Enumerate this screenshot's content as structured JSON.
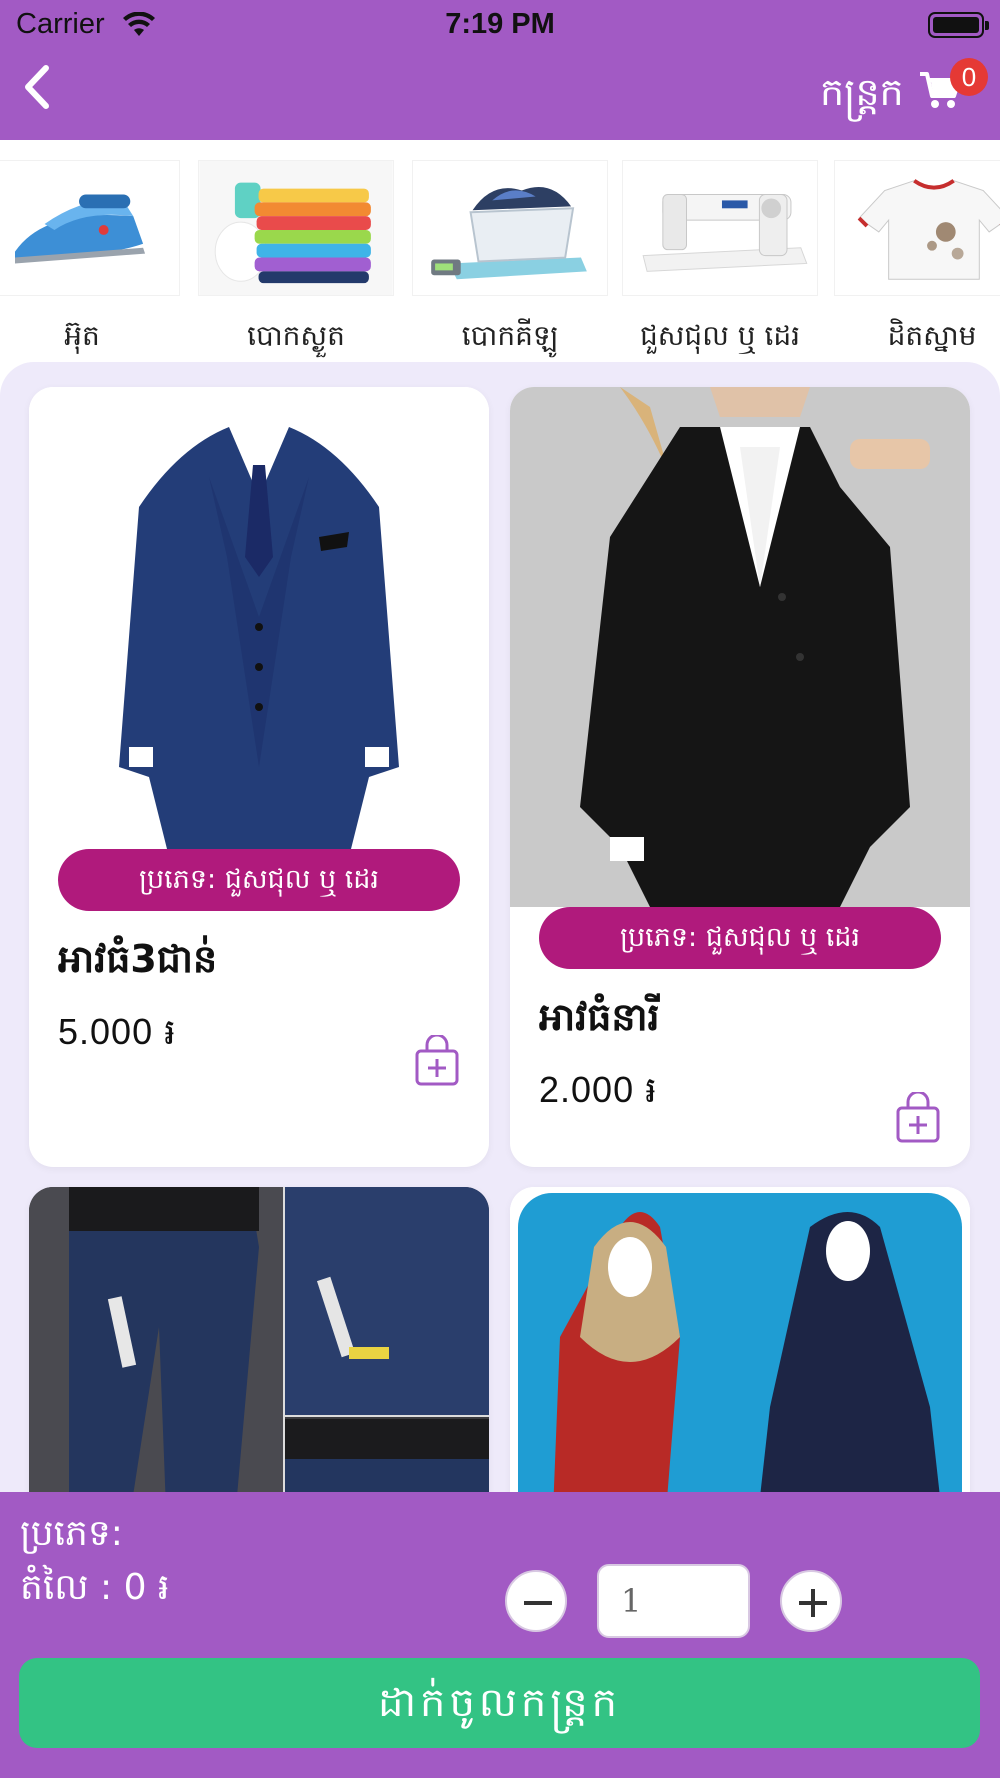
{
  "status_bar": {
    "carrier": "Carrier",
    "time": "7:19 PM"
  },
  "header": {
    "cart_label": "កន្ត្រក",
    "cart_count": "0"
  },
  "categories": [
    {
      "label": "អ៊ុត",
      "icon": "iron-icon"
    },
    {
      "label": "បោកស្ងួត",
      "icon": "folded-clothes-icon"
    },
    {
      "label": "បោកគីឡូ",
      "icon": "laundry-basket-scale-icon"
    },
    {
      "label": "ជួសជុល ឬ ដេរ",
      "icon": "sewing-machine-icon"
    },
    {
      "label": "ដិតស្នាម",
      "icon": "stained-shirt-icon"
    }
  ],
  "products": [
    {
      "type_label": "ប្រភេទ: ជួសជុល ឬ ដេរ",
      "name": "អាវធំ3ជាន់",
      "price": "5.000 ៛",
      "image": "mens-three-piece-suit"
    },
    {
      "type_label": "ប្រភេទ: ជួសជុល ឬ ដេរ",
      "name": "អាវធំនារី",
      "price": "2.000 ៛",
      "image": "womens-black-blazer"
    },
    {
      "image": "denim-jeans"
    },
    {
      "image": "hijab-dresses"
    }
  ],
  "bottom": {
    "type_label": "ប្រភេទ:",
    "price_label": "តំលៃ : 0 ៛",
    "quantity": "1",
    "add_to_cart": "ដាក់ចូលកន្ត្រក"
  },
  "colors": {
    "primary": "#a25ac4",
    "pill": "#b01a7c",
    "button": "#33c384",
    "badge": "#e53935",
    "background": "#eeeafa"
  }
}
